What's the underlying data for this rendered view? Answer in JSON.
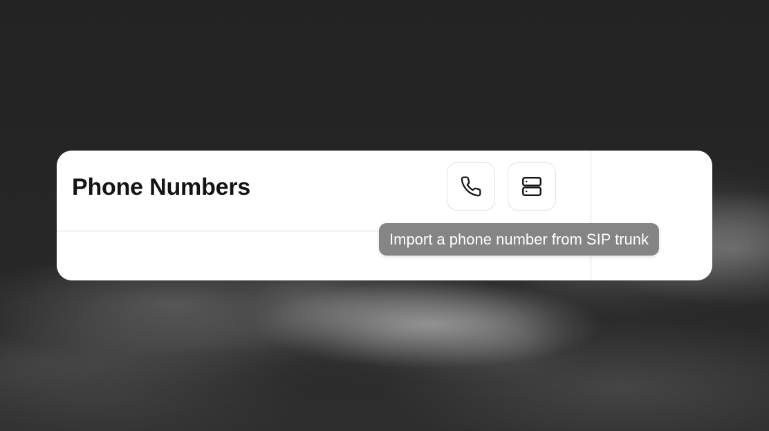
{
  "page": {
    "title": "Phone Numbers"
  },
  "toolbar": {
    "buttons": [
      {
        "id": "phone",
        "icon": "phone-icon"
      },
      {
        "id": "sip-trunk",
        "icon": "server-icon"
      }
    ]
  },
  "tooltip": {
    "text": "Import a phone number from SIP trunk"
  },
  "colors": {
    "background": "#242424",
    "card": "#ffffff",
    "title_text": "#141414",
    "border": "#e3e3e3",
    "tooltip_bg": "#808080",
    "tooltip_text": "#ffffff"
  }
}
